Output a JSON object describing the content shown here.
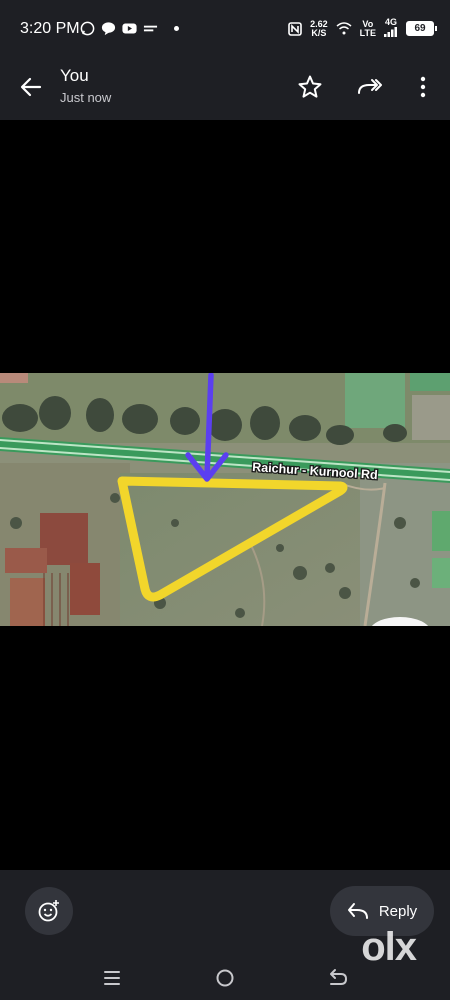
{
  "status_bar": {
    "time": "3:20 PM",
    "speed_value": "2.62",
    "speed_unit": "K/S",
    "network_top": "Vo",
    "network_bottom": "LTE",
    "signal_label": "4G",
    "battery": "69"
  },
  "header": {
    "title": "You",
    "subtitle": "Just now",
    "back_icon": "arrow-left-icon",
    "star_icon": "star-icon",
    "forward_icon": "forward-icon",
    "more_icon": "more-vertical-icon"
  },
  "image": {
    "road_label": "Raichur - Kurnool Rd",
    "highlight_color": "#f2d62b",
    "arrow_color": "#5b3ff0",
    "road_color": "#3a9a5c"
  },
  "bottom": {
    "reply_label": "Reply",
    "watermark": "olx"
  }
}
